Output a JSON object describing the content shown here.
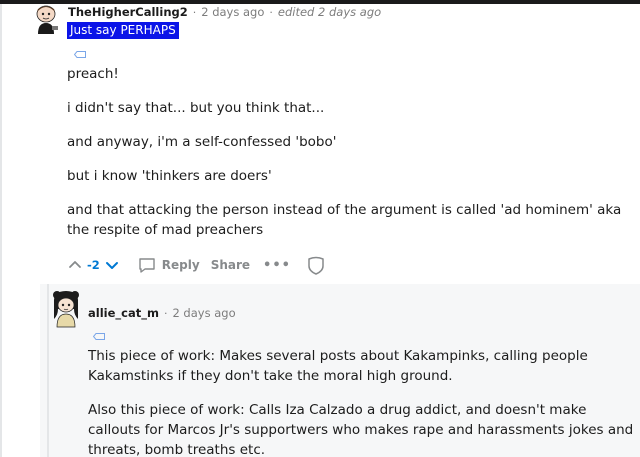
{
  "comment": {
    "username": "TheHigherCalling2",
    "time": "2 days ago",
    "edited": "edited 2 days ago",
    "flair": "Just say PERHAPS",
    "paragraphs": [
      "preach!",
      "i didn't say that... but you think that...",
      "and anyway, i'm a self-confessed 'bobo'",
      "but i know 'thinkers are doers'",
      "and that attacking the person instead of the argument is called 'ad hominem' aka the respite of mad preachers"
    ],
    "score": "-2",
    "actions": {
      "reply_label": "Reply",
      "share_label": "Share",
      "more_label": "•••"
    }
  },
  "reply": {
    "username": "allie_cat_m",
    "time": "2 days ago",
    "paragraphs": [
      "This piece of work: Makes several posts about Kakampinks, calling people Kakamstinks if they don't take the moral high ground.",
      "Also this piece of work: Calls Iza Calzado a drug addict, and doesn't make callouts for Marcos Jr's supportwers who makes rape and harassments jokes and threats, bomb treaths etc."
    ]
  },
  "colors": {
    "flair_bg": "#0b14e8",
    "score": "#0079d3",
    "meta": "#7c7c7c",
    "reply_bg": "#f6f7f8"
  },
  "icons": [
    "upvote-icon",
    "downvote-icon",
    "reply-bubble-icon",
    "shield-icon",
    "award-tag-icon",
    "user-avatar-icon"
  ]
}
